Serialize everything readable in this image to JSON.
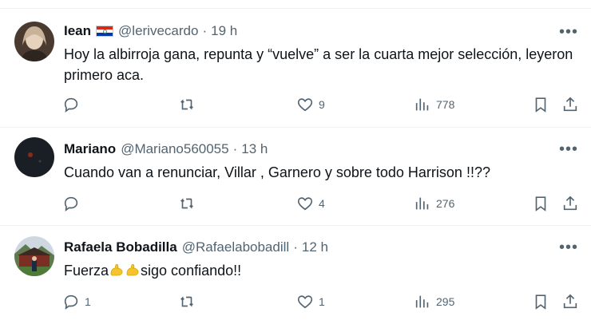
{
  "tweets": [
    {
      "name": "Iean",
      "handle": "@lerivecardo",
      "dot": "·",
      "time": "19 h",
      "text": "Hoy la albirroja gana, repunta y “vuelve” a ser la cuarta mejor selección, leyeron primero aca.",
      "replies": "",
      "retweets": "",
      "likes": "9",
      "views": "778"
    },
    {
      "name": "Mariano",
      "handle": "@Mariano560055",
      "dot": "·",
      "time": "13 h",
      "text": "Cuando van a renunciar, Villar , Garnero y sobre todo Harrison !!??",
      "replies": "",
      "retweets": "",
      "likes": "4",
      "views": "276"
    },
    {
      "name": "Rafaela Bobadilla",
      "handle": "@Rafaelabobadill",
      "dot": "·",
      "time": "12 h",
      "text_before": "Fuerza",
      "text_after": "sigo confiando!!",
      "replies": "1",
      "retweets": "",
      "likes": "1",
      "views": "295"
    }
  ],
  "icons": {
    "more": "more-icon",
    "reply": "reply-icon",
    "retweet": "retweet-icon",
    "like": "heart-icon",
    "views": "views-icon",
    "bookmark": "bookmark-icon",
    "share": "share-icon",
    "emoji": "flexed-biceps-emoji"
  },
  "colors": {
    "text": "#0f1419",
    "secondary": "#536471",
    "border": "#eff3f4"
  }
}
